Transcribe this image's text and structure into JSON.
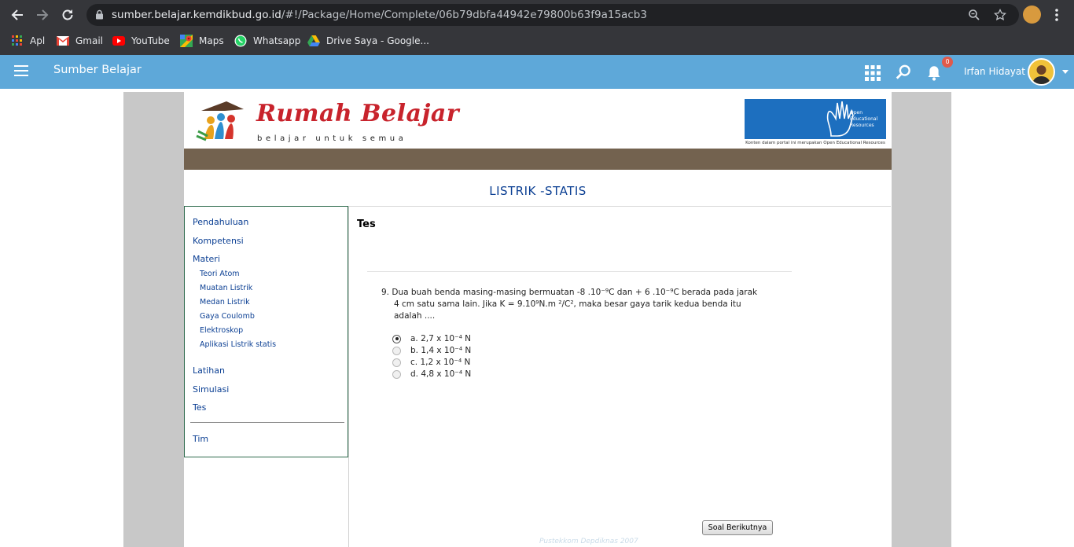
{
  "browser": {
    "url_host": "sumber.belajar.kemdikbud.go.id",
    "url_path": "/#!/Package/Home/Complete/06b79dbfa44942e79800b63f9a15acb3",
    "bookmarks": [
      {
        "label": "Apl",
        "icon": "apps-grid-icon"
      },
      {
        "label": "Gmail",
        "icon": "gmail-icon"
      },
      {
        "label": "YouTube",
        "icon": "youtube-icon"
      },
      {
        "label": "Maps",
        "icon": "maps-icon"
      },
      {
        "label": "Whatsapp",
        "icon": "whatsapp-icon"
      },
      {
        "label": "Drive Saya - Google...",
        "icon": "google-drive-icon"
      }
    ]
  },
  "app": {
    "title": "Sumber Belajar",
    "notification_count": "0",
    "user_name": "Irfan Hidayat",
    "accent_color": "#5ea8d9"
  },
  "banner": {
    "brand_title": "Rumah Belajar",
    "brand_tagline": "belajar untuk semua",
    "oer_label": "Open Educational Resources",
    "oer_caption": "Konten dalam portal ini merupakan Open Educational Resources"
  },
  "page": {
    "title": "LISTRIK -STATIS",
    "content_title": "Tes",
    "footer": "Pustekkom Depdiknas 2007"
  },
  "nav": {
    "items": [
      {
        "label": "Pendahuluan"
      },
      {
        "label": "Kompetensi"
      },
      {
        "label": "Materi"
      }
    ],
    "sub_items": [
      {
        "label": "Teori Atom"
      },
      {
        "label": "Muatan Listrik"
      },
      {
        "label": "Medan Listrik"
      },
      {
        "label": "Gaya Coulomb"
      },
      {
        "label": "Elektroskop"
      },
      {
        "label": "Aplikasi Listrik statis"
      }
    ],
    "items_after": [
      {
        "label": "Latihan"
      },
      {
        "label": "Simulasi"
      },
      {
        "label": "Tes"
      }
    ],
    "team": "Tim"
  },
  "question": {
    "line1": "9. Dua buah benda masing-masing bermuatan -8 .10⁻⁹C dan + 6 .10⁻⁹C berada pada jarak",
    "line2": "4 cm satu sama lain. Jika K = 9.10⁹N.m ²/C², maka besar gaya tarik kedua benda itu",
    "line3": "adalah ....",
    "options": [
      {
        "label": "a. 2,7 x 10⁻⁴ N",
        "selected": true
      },
      {
        "label": "b. 1,4 x 10⁻⁴ N",
        "selected": false
      },
      {
        "label": "c. 1,2 x 10⁻⁴ N",
        "selected": false
      },
      {
        "label": "d. 4,8 x 10⁻⁴ N",
        "selected": false
      }
    ],
    "next_button": "Soal Berikutnya"
  }
}
